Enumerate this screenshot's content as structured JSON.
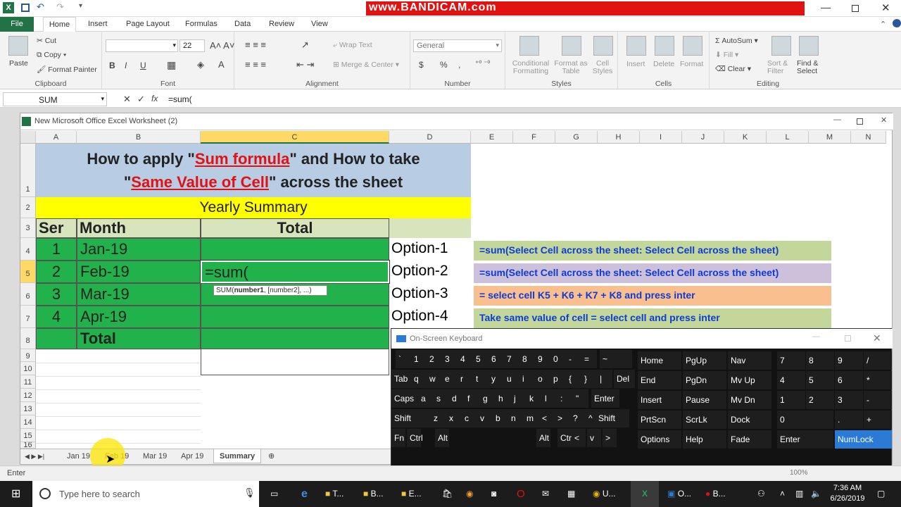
{
  "app": {
    "excel_logo": "X",
    "watermark": "www.BANDICAM.com"
  },
  "ribbon_tabs": [
    "File",
    "Home",
    "Insert",
    "Page Layout",
    "Formulas",
    "Data",
    "Review",
    "View"
  ],
  "clipboard": {
    "paste": "Paste",
    "cut": "Cut",
    "copy": "Copy",
    "format_painter": "Format Painter",
    "label": "Clipboard"
  },
  "font": {
    "size": "22",
    "bold": "B",
    "italic": "I",
    "underline": "U",
    "label": "Font"
  },
  "alignment": {
    "wrap": "Wrap Text",
    "merge": "Merge & Center",
    "label": "Alignment"
  },
  "number": {
    "format": "General",
    "dollar": "$",
    "percent": "%",
    "comma": ",",
    "label": "Number"
  },
  "styles": {
    "conditional": "Conditional Formatting",
    "format_table": "Format as Table",
    "cell_styles": "Cell Styles",
    "label": "Styles"
  },
  "cells": {
    "insert": "Insert",
    "delete": "Delete",
    "format": "Format",
    "label": "Cells"
  },
  "editing": {
    "autosum": "AutoSum",
    "fill": "Fill",
    "clear": "Clear",
    "sort": "Sort & Filter",
    "find": "Find & Select",
    "label": "Editing"
  },
  "formula_bar": {
    "name_box": "SUM",
    "fx": "fx",
    "formula": "=sum("
  },
  "workbook": {
    "title": "New Microsoft Office Excel Worksheet (2)"
  },
  "columns": [
    "A",
    "B",
    "C",
    "D",
    "E",
    "F",
    "G",
    "H",
    "I",
    "J",
    "K",
    "L",
    "M",
    "N"
  ],
  "rows": [
    "1",
    "2",
    "3",
    "4",
    "5",
    "6",
    "7",
    "8",
    "9",
    "10",
    "11",
    "12",
    "13",
    "14",
    "15",
    "16"
  ],
  "sheet": {
    "title_line1_a": "How to apply \"",
    "title_line1_red": "Sum formula",
    "title_line1_b": "\" and How to take",
    "title_line2_a": "\"",
    "title_line2_red": "Same Value of Cell",
    "title_line2_b": "\" across the sheet",
    "yearly": "Yearly Summary",
    "hdr_ser": "Ser",
    "hdr_month": "Month",
    "hdr_total": "Total",
    "data": [
      {
        "ser": "1",
        "month": "Jan-19"
      },
      {
        "ser": "2",
        "month": "Feb-19"
      },
      {
        "ser": "3",
        "month": "Mar-19"
      },
      {
        "ser": "4",
        "month": "Apr-19"
      }
    ],
    "total_label": "Total",
    "edit_text": "=sum(",
    "tooltip_a": "SUM(",
    "tooltip_b": "number1",
    ", [number2], ...)": "",
    "tooltip_c": ", [number2], ...)",
    "options": [
      "Option-1",
      "Option-2",
      "Option-3",
      "Option-4"
    ],
    "notes": [
      "=sum(Select Cell across the sheet: Select Cell across the sheet)",
      "=sum(Select Cell across the sheet: Select Cell across the sheet)",
      "= select  cell  K5 + K6 + K7 + K8   and press inter",
      "Take same value of cell  = select cell and press inter"
    ]
  },
  "sheet_tabs": [
    "Jan 19",
    "Feb 19",
    "Mar 19",
    "Apr 19",
    "Summary"
  ],
  "status": {
    "mode": "Enter",
    "zoom": "100%"
  },
  "osk": {
    "title": "On-Screen Keyboard",
    "row1": [
      "~",
      "!",
      "@",
      "#",
      "$",
      "%",
      "^",
      "&",
      "*",
      "(",
      ")",
      "_",
      "+"
    ],
    "row1b": [
      "`",
      "1",
      "2",
      "3",
      "4",
      "5",
      "6",
      "7",
      "8",
      "9",
      "0",
      "-",
      "="
    ],
    "row2": [
      "Tab",
      "q",
      "w",
      "e",
      "r",
      "t",
      "y",
      "u",
      "i",
      "o",
      "p",
      "{",
      "}",
      "|",
      "Del"
    ],
    "row3": [
      "Caps",
      "a",
      "s",
      "d",
      "f",
      "g",
      "h",
      "j",
      "k",
      "l",
      ":",
      "\"",
      "Enter"
    ],
    "row4": [
      "Shift",
      "z",
      "x",
      "c",
      "v",
      "b",
      "n",
      "m",
      "<",
      ">",
      "?",
      "^",
      "Shift"
    ],
    "row5": [
      "Fn",
      "Ctrl",
      "Alt",
      "Alt",
      "Ctrl",
      "<",
      "v",
      ">"
    ],
    "nav": [
      [
        "Home",
        "PgUp",
        "Nav"
      ],
      [
        "End",
        "PgDn",
        "Mv Up"
      ],
      [
        "Insert",
        "Pause",
        "Mv Dn"
      ],
      [
        "PrtScn",
        "ScrLk",
        "Dock"
      ],
      [
        "Options",
        "Help",
        "Fade"
      ]
    ],
    "numpad": [
      [
        "7",
        "8",
        "9",
        "/"
      ],
      [
        "4",
        "5",
        "6",
        "*"
      ],
      [
        "1",
        "2",
        "3",
        "-"
      ],
      [
        "0",
        ".",
        "+"
      ],
      [
        "Enter",
        "NumLock"
      ]
    ]
  },
  "taskbar": {
    "search": "Type here to search",
    "items": [
      "T...",
      "B...",
      "E...",
      "U...",
      "O...",
      "B..."
    ],
    "time": "7:36 AM",
    "date": "6/26/2019"
  },
  "colors": {
    "excel_green": "#217346",
    "cell_green": "#22b24c",
    "title_blue": "#b8cce4",
    "yellow": "#ffff00",
    "header_tan": "#d8e4bc",
    "note_green": "#c4d79b",
    "note_purple": "#ccc0da",
    "note_orange": "#fabf8f",
    "bandicam_red": "#e01212"
  }
}
